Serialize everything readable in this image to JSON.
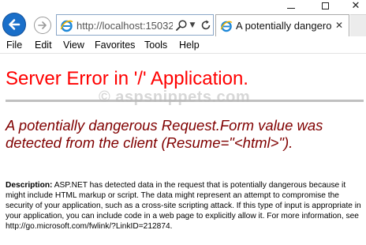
{
  "browser": {
    "address": {
      "url": "http://localhost:15032"
    },
    "tab": {
      "title": "A potentially dangero..."
    },
    "menu": [
      "File",
      "Edit",
      "View",
      "Favorites",
      "Tools",
      "Help"
    ],
    "icons": {
      "back": "back-arrow-icon",
      "forward": "forward-arrow-icon",
      "site": "ie-icon",
      "search": "search-icon",
      "dropdown": "chevron-down-icon",
      "refresh": "refresh-icon",
      "tab_close": "close-icon"
    }
  },
  "page": {
    "title": "Server Error in '/' Application.",
    "watermark": "© aspsnippets.com",
    "message": "A potentially dangerous Request.Form value was detected from the client (Resume=\"<html>\").",
    "description_label": "Description:",
    "description_text": " ASP.NET has detected data in the request that is potentially dangerous because it might include HTML markup or script. The data might represent an attempt to compromise the security of your application, such as a cross-site scripting attack. If this type of input is appropriate in your application, you can include code in a web page to explicitly allow it. For more information, see http://go.microsoft.com/fwlink/?LinkID=212874."
  },
  "colors": {
    "error_title": "#ff0000",
    "error_message": "#800000",
    "back_button": "#1a6fc9",
    "ie_blue": "#1e88d8"
  }
}
